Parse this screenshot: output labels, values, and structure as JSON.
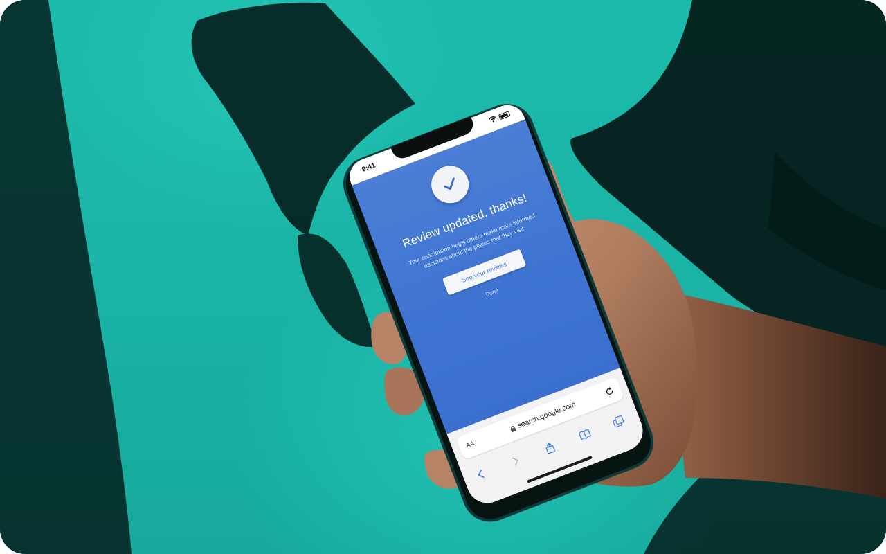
{
  "phone": {
    "status_time": "9:41",
    "title": "Review updated, thanks!",
    "description": "Your contribution helps others make more informed decisions about the places that they visit.",
    "primary_button": "See your reviews",
    "secondary_button": "Done",
    "browser": {
      "text_size_label": "AA",
      "url": "search.google.com"
    }
  },
  "icons": [
    "wifi-icon",
    "battery-icon",
    "check-icon",
    "lock-icon",
    "reload-icon",
    "back-icon",
    "forward-icon",
    "share-icon",
    "bookmarks-icon",
    "tabs-icon"
  ],
  "colors": {
    "background": "#1db8aa",
    "screen_blue": "#4077d2",
    "button_text": "#3c6fd0",
    "browser_bar": "#f2f2f4"
  }
}
